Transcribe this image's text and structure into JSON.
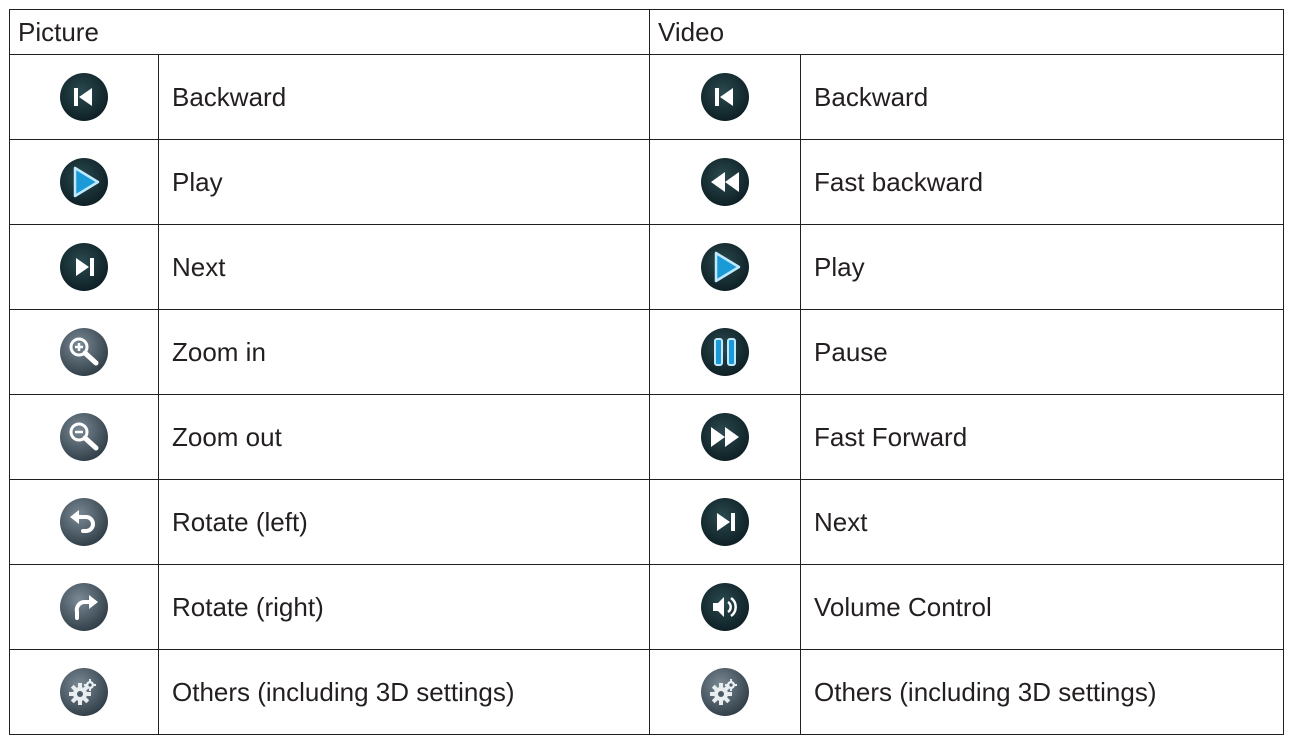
{
  "headers": {
    "picture": "Picture",
    "video": "Video"
  },
  "picture_rows": [
    {
      "icon": "backward-icon",
      "label": "Backward"
    },
    {
      "icon": "play-icon",
      "label": "Play"
    },
    {
      "icon": "next-icon",
      "label": "Next"
    },
    {
      "icon": "zoom-in-icon",
      "label": "Zoom in"
    },
    {
      "icon": "zoom-out-icon",
      "label": "Zoom out"
    },
    {
      "icon": "rotate-left-icon",
      "label": "Rotate (left)"
    },
    {
      "icon": "rotate-right-icon",
      "label": "Rotate (right)"
    },
    {
      "icon": "settings-icon",
      "label": "Others (including 3D settings)"
    }
  ],
  "video_rows": [
    {
      "icon": "backward-icon",
      "label": "Backward"
    },
    {
      "icon": "fast-backward-icon",
      "label": "Fast backward"
    },
    {
      "icon": "play-icon",
      "label": "Play"
    },
    {
      "icon": "pause-icon",
      "label": "Pause"
    },
    {
      "icon": "fast-forward-icon",
      "label": "Fast Forward"
    },
    {
      "icon": "next-icon",
      "label": "Next"
    },
    {
      "icon": "volume-icon",
      "label": "Volume Control"
    },
    {
      "icon": "settings-icon",
      "label": "Others (including 3D settings)"
    }
  ],
  "colors": {
    "icon_dark": "#0f2a2f",
    "icon_gray": "#3d4f5b",
    "icon_accent": "#1a9bd7",
    "border": "#231f20"
  }
}
